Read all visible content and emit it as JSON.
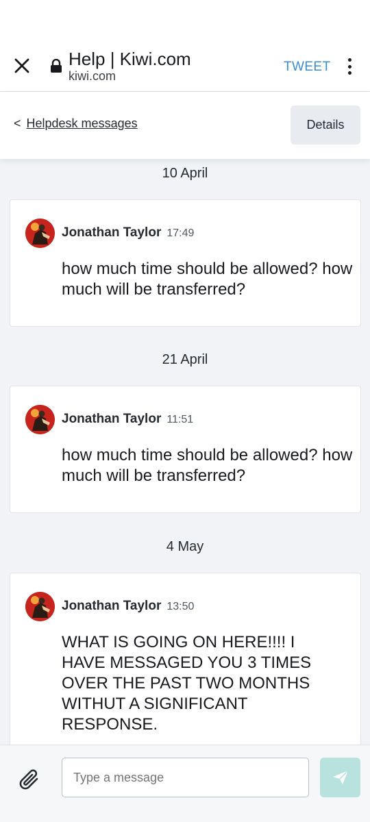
{
  "browser": {
    "title": "Help | Kiwi.com",
    "url": "kiwi.com",
    "tweet_label": "TWEET"
  },
  "subheader": {
    "back_label": "Helpdesk messages",
    "back_chevron": "<",
    "details_label": "Details"
  },
  "messages": [
    {
      "date": "10 April",
      "author": "Jonathan Taylor",
      "time": "17:49",
      "text": "how much time should be allowed? how much will be transferred?"
    },
    {
      "date": "21 April",
      "author": "Jonathan Taylor",
      "time": "11:51",
      "text": "how much time should be allowed? how much will be transferred?"
    },
    {
      "date": "4 May",
      "author": "Jonathan Taylor",
      "time": "13:50",
      "text": "WHAT IS GOING ON HERE!!!! I HAVE MESSAGED YOU 3 TIMES OVER THE PAST TWO MONTHS WITHUT A SIGNIFICANT RESPONSE."
    }
  ],
  "composer": {
    "placeholder": "Type a message"
  },
  "colors": {
    "accent_link": "#3a8bd6",
    "send_button": "#b7e2de",
    "avatar_bg": "#c6241d"
  },
  "icons": [
    "close-icon",
    "lock-icon",
    "more-vertical-icon",
    "chevron-left-icon",
    "avatar",
    "paperclip-icon",
    "send-icon"
  ]
}
